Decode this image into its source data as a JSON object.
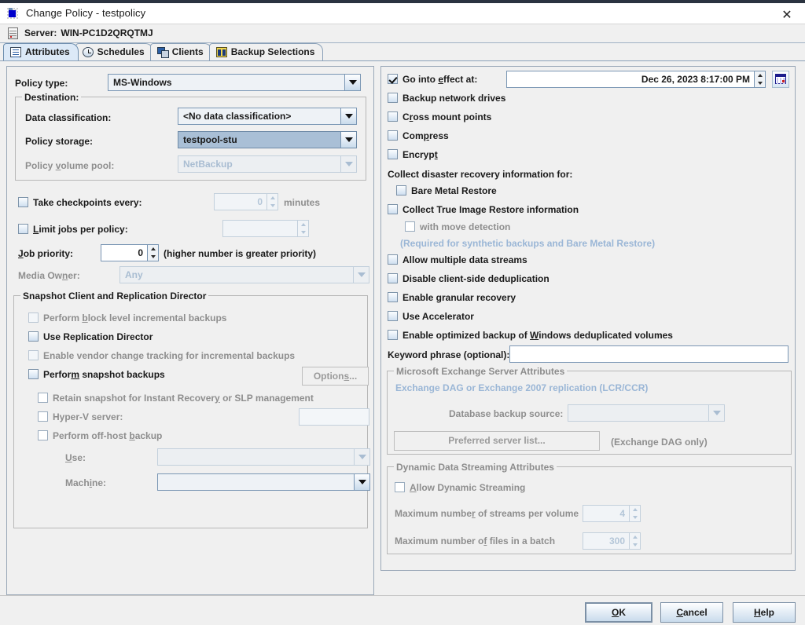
{
  "window": {
    "title": "Change Policy - testpolicy",
    "app_icon": "policy-icon",
    "close_label": "✕"
  },
  "server_bar": {
    "label": "Server:",
    "name": "WIN-PC1D2QRQTMJ",
    "icon": "server-icon"
  },
  "tabs": [
    {
      "label": "Attributes",
      "icon": "attributes-icon",
      "active": true
    },
    {
      "label": "Schedules",
      "icon": "clock-icon",
      "active": false
    },
    {
      "label": "Clients",
      "icon": "computers-icon",
      "active": false
    },
    {
      "label": "Backup Selections",
      "icon": "selections-icon",
      "active": false
    }
  ],
  "left": {
    "policy_type": {
      "label": "Policy type:",
      "value": "MS-Windows"
    },
    "destination": {
      "group_label": "Destination:",
      "data_classification": {
        "label": "Data classification:",
        "value": "<No data classification>"
      },
      "policy_storage": {
        "label": "Policy storage:",
        "value": "testpool-stu"
      },
      "policy_volume_pool": {
        "label": "Policy volume pool:",
        "value": "NetBackup"
      }
    },
    "take_checkpoints": {
      "label": "Take checkpoints every:",
      "checked": false,
      "value": "0",
      "units": "minutes"
    },
    "limit_jobs": {
      "label": "Limit jobs per policy:",
      "checked": false,
      "value": ""
    },
    "job_priority": {
      "label": "Job priority:",
      "value": "0",
      "hint": "(higher number is greater priority)"
    },
    "media_owner": {
      "label": "Media Owner:",
      "value": "Any"
    },
    "snapshot": {
      "group_label": "Snapshot Client and Replication Director",
      "block_level": {
        "label": "Perform block level incremental backups",
        "checked": false
      },
      "replication_director": {
        "label": "Use Replication Director",
        "checked": false
      },
      "vendor_change": {
        "label": "Enable vendor change tracking for incremental backups",
        "checked": false
      },
      "perform_snapshot": {
        "label": "Perform snapshot backups",
        "checked": false
      },
      "options_button": "Options...",
      "retain_snapshot": {
        "label": "Retain snapshot for Instant Recovery or SLP management",
        "checked": false
      },
      "hyperv_server": {
        "label": "Hyper-V server:",
        "checked": false,
        "value": ""
      },
      "offhost_backup": {
        "label": "Perform off-host backup",
        "checked": false
      },
      "use": {
        "label": "Use:",
        "value": ""
      },
      "machine": {
        "label": "Machine:",
        "value": ""
      }
    }
  },
  "right": {
    "go_into_effect": {
      "label": "Go into effect at:",
      "checked": true,
      "value": "Dec 26, 2023 8:17:00 PM",
      "calendar_icon": "calendar-icon"
    },
    "backup_network_drives": {
      "label": "Backup network drives",
      "checked": false
    },
    "cross_mount_points": {
      "label": "Cross mount points",
      "checked": false
    },
    "compress": {
      "label": "Compress",
      "checked": false
    },
    "encrypt": {
      "label": "Encrypt",
      "checked": false
    },
    "collect_dr_label": "Collect disaster recovery information for:",
    "bare_metal_restore": {
      "label": "Bare Metal Restore",
      "checked": false
    },
    "collect_tir": {
      "label": "Collect True Image Restore information",
      "checked": false
    },
    "with_move_detection": {
      "label": "with move detection",
      "checked": false
    },
    "tir_note": "(Required for synthetic backups and Bare Metal Restore)",
    "multiple_streams": {
      "label": "Allow multiple data streams",
      "checked": false
    },
    "disable_client_dedup": {
      "label": "Disable client-side deduplication",
      "checked": false
    },
    "granular_recovery": {
      "label": "Enable granular recovery",
      "checked": false
    },
    "use_accelerator": {
      "label": "Use Accelerator",
      "checked": false
    },
    "optimized_backup": {
      "label": "Enable optimized backup of Windows deduplicated volumes",
      "checked": false
    },
    "keyword_phrase": {
      "label": "Keyword phrase (optional):",
      "value": ""
    },
    "exchange": {
      "group_label": "Microsoft Exchange Server Attributes",
      "dag_note": "Exchange DAG or Exchange 2007 replication (LCR/CCR)",
      "database_backup_source": {
        "label": "Database backup source:",
        "value": ""
      },
      "preferred_server_button": "Preferred server list...",
      "dag_only": "(Exchange DAG only)"
    },
    "dynamic": {
      "group_label": "Dynamic Data Streaming Attributes",
      "allow_dynamic": {
        "label": "Allow Dynamic Streaming",
        "checked": false
      },
      "max_streams": {
        "label": "Maximum number of streams per volume",
        "value": "4"
      },
      "max_files": {
        "label": "Maximum number of files in a batch",
        "value": "300"
      }
    }
  },
  "footer": {
    "ok": "OK",
    "cancel": "Cancel",
    "help": "Help"
  },
  "colors": {
    "dialog_bg": "#f0f0f0",
    "selected_combo": "#a9bfd6",
    "active_tab": "#dce9f7",
    "disabled_text": "#8e8e8e",
    "blue_hint_text": "#9ab6d6",
    "border": "#9aa8b8"
  }
}
